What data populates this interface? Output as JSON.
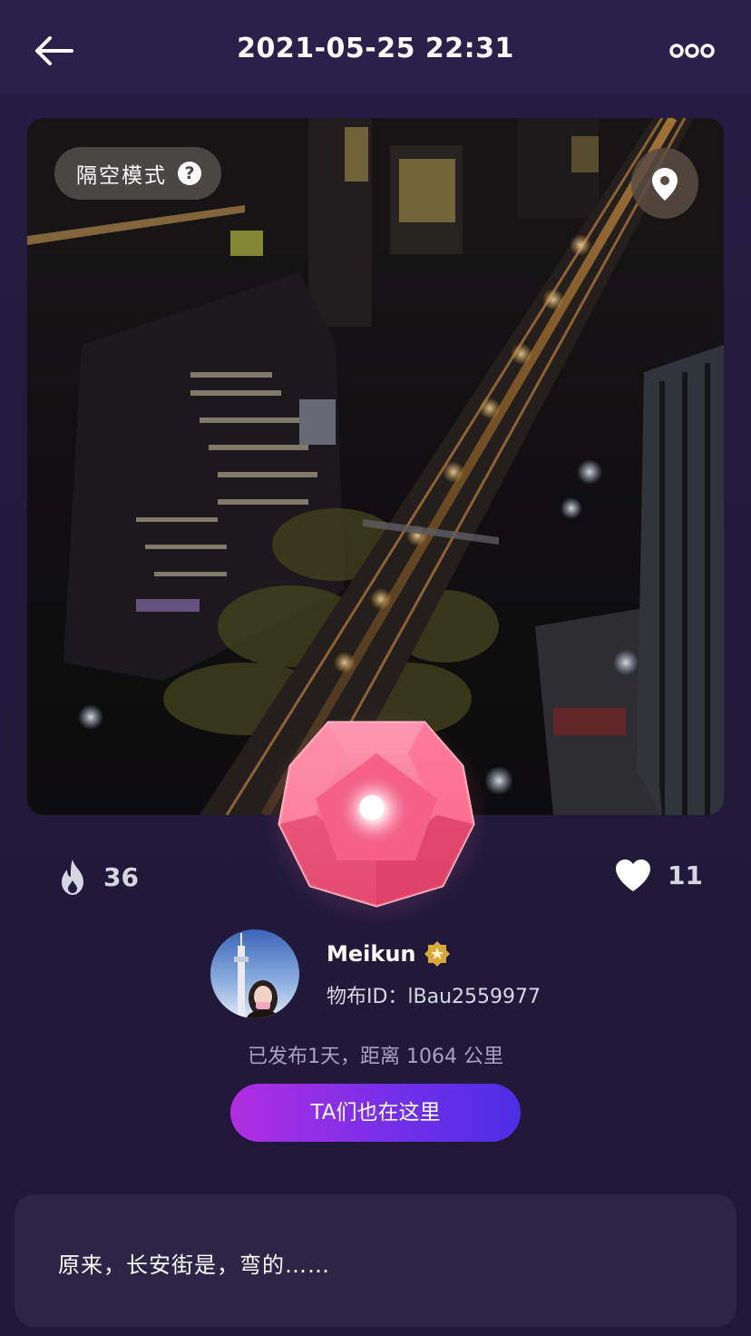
{
  "header": {
    "back_icon": "arrow-left-icon",
    "title": "2021-05-25 22:31",
    "more_icon": "ellipsis-icon"
  },
  "photo": {
    "subject": "night city street aerial",
    "mode_label": "隔空模式",
    "mode_help_icon": "question-circle-icon",
    "mode_help_glyph": "?",
    "location_icon": "map-pin-icon"
  },
  "gem": {
    "icon": "pink-gem-icon",
    "color": "#f05a7e"
  },
  "stats": {
    "heat_icon": "flame-icon",
    "heat_count": "36",
    "like_icon": "heart-icon",
    "like_count": "11"
  },
  "user": {
    "avatar_icon": "avatar",
    "name": "Meikun",
    "badge_icon": "gold-badge-icon",
    "id_text": "物布ID：lBau2559977"
  },
  "post": {
    "publish_info": "已发布1天，距离 1064 公里",
    "action_label": "TA们也在这里"
  },
  "comment": {
    "text": "原来，长安街是，弯的……"
  },
  "colors": {
    "background": "#221a3d",
    "topbar": "#2a2049",
    "button_gradient_start": "#b22ee0",
    "button_gradient_end": "#4a2ee6",
    "card": "#2d2548",
    "muted_text": "#a9a4bd"
  }
}
